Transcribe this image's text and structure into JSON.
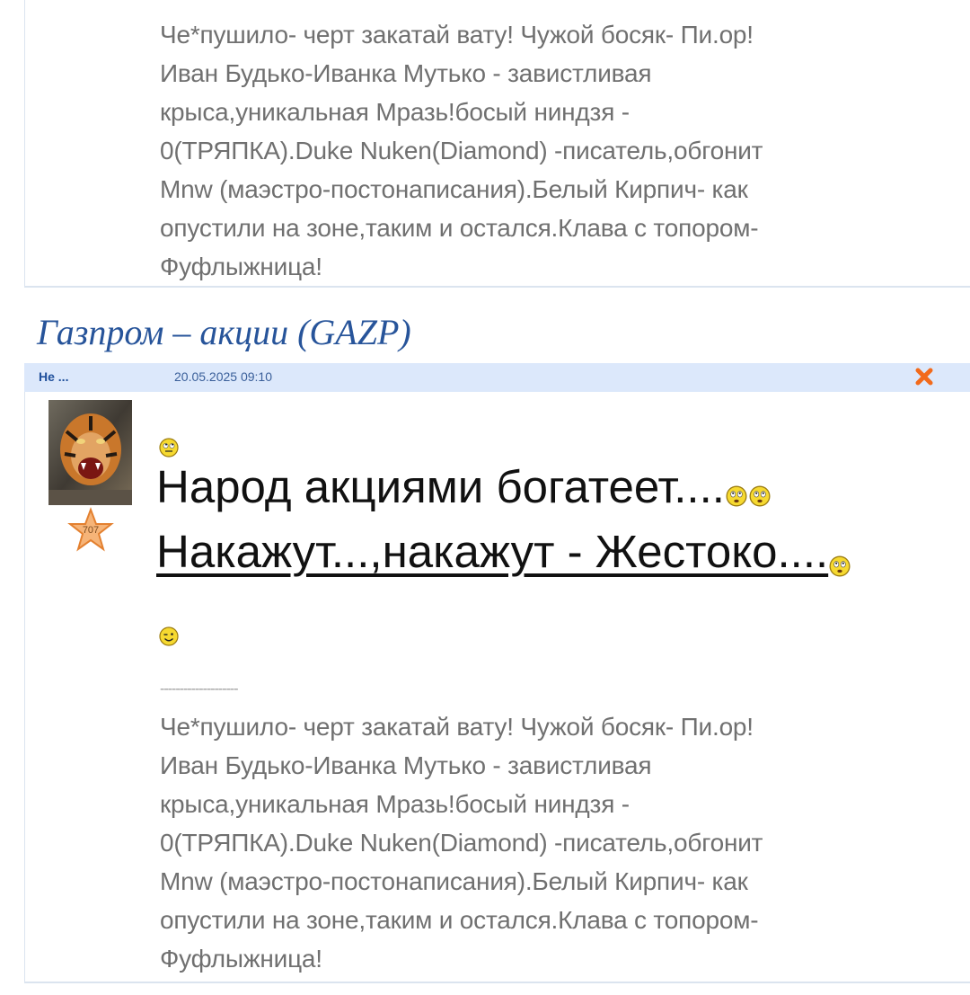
{
  "previous_post": {
    "signature": "Че*пушило- черт закатай вату! Чужой босяк- Пи.ор!\nИван Будько-Иванка Мутько - завистливая\nкрыса,уникальная Мразь!босый ниндзя -\n0(ТРЯПКА).Duke Nuken(Diamond) -писатель,обгонит\nMnw (маэстро-постонаписания).Белый Кирпич- как\nопустили на зоне,таким и остался.Клава с топором-\nФуфлыжница!"
  },
  "topic": {
    "title": "Газпром – акции (GAZP)"
  },
  "post": {
    "author": "Не ...",
    "date": "20.05.2025 09:10",
    "rank": "707",
    "line1": "Народ акциями богатеет....",
    "line2": "Накажут...,накажут - Жестоко....",
    "divider": "--------------------",
    "signature": "Че*пушило- черт закатай вату! Чужой босяк- Пи.ор!\nИван Будько-Иванка Мутько - завистливая\nкрыса,уникальная Мразь!босый ниндзя -\n0(ТРЯПКА).Duke Nuken(Diamond) -писатель,обгонит\nMnw (маэстро-постонаписания).Белый Кирпич- как\nопустили на зоне,таким и остался.Клава с топором-\nФуфлыжница!"
  },
  "icons": {
    "delete": "close-x-icon",
    "avatar": "tiger-avatar",
    "rank": "star-icon",
    "smileys": [
      "rolling-eyes-smiley",
      "worried-smiley",
      "worried-smiley",
      "worried-smiley",
      "wink-smiley"
    ]
  },
  "colors": {
    "header_bg": "#dce8fb",
    "title": "#27549a",
    "delete": "#f26a1b",
    "signature": "#707070"
  }
}
